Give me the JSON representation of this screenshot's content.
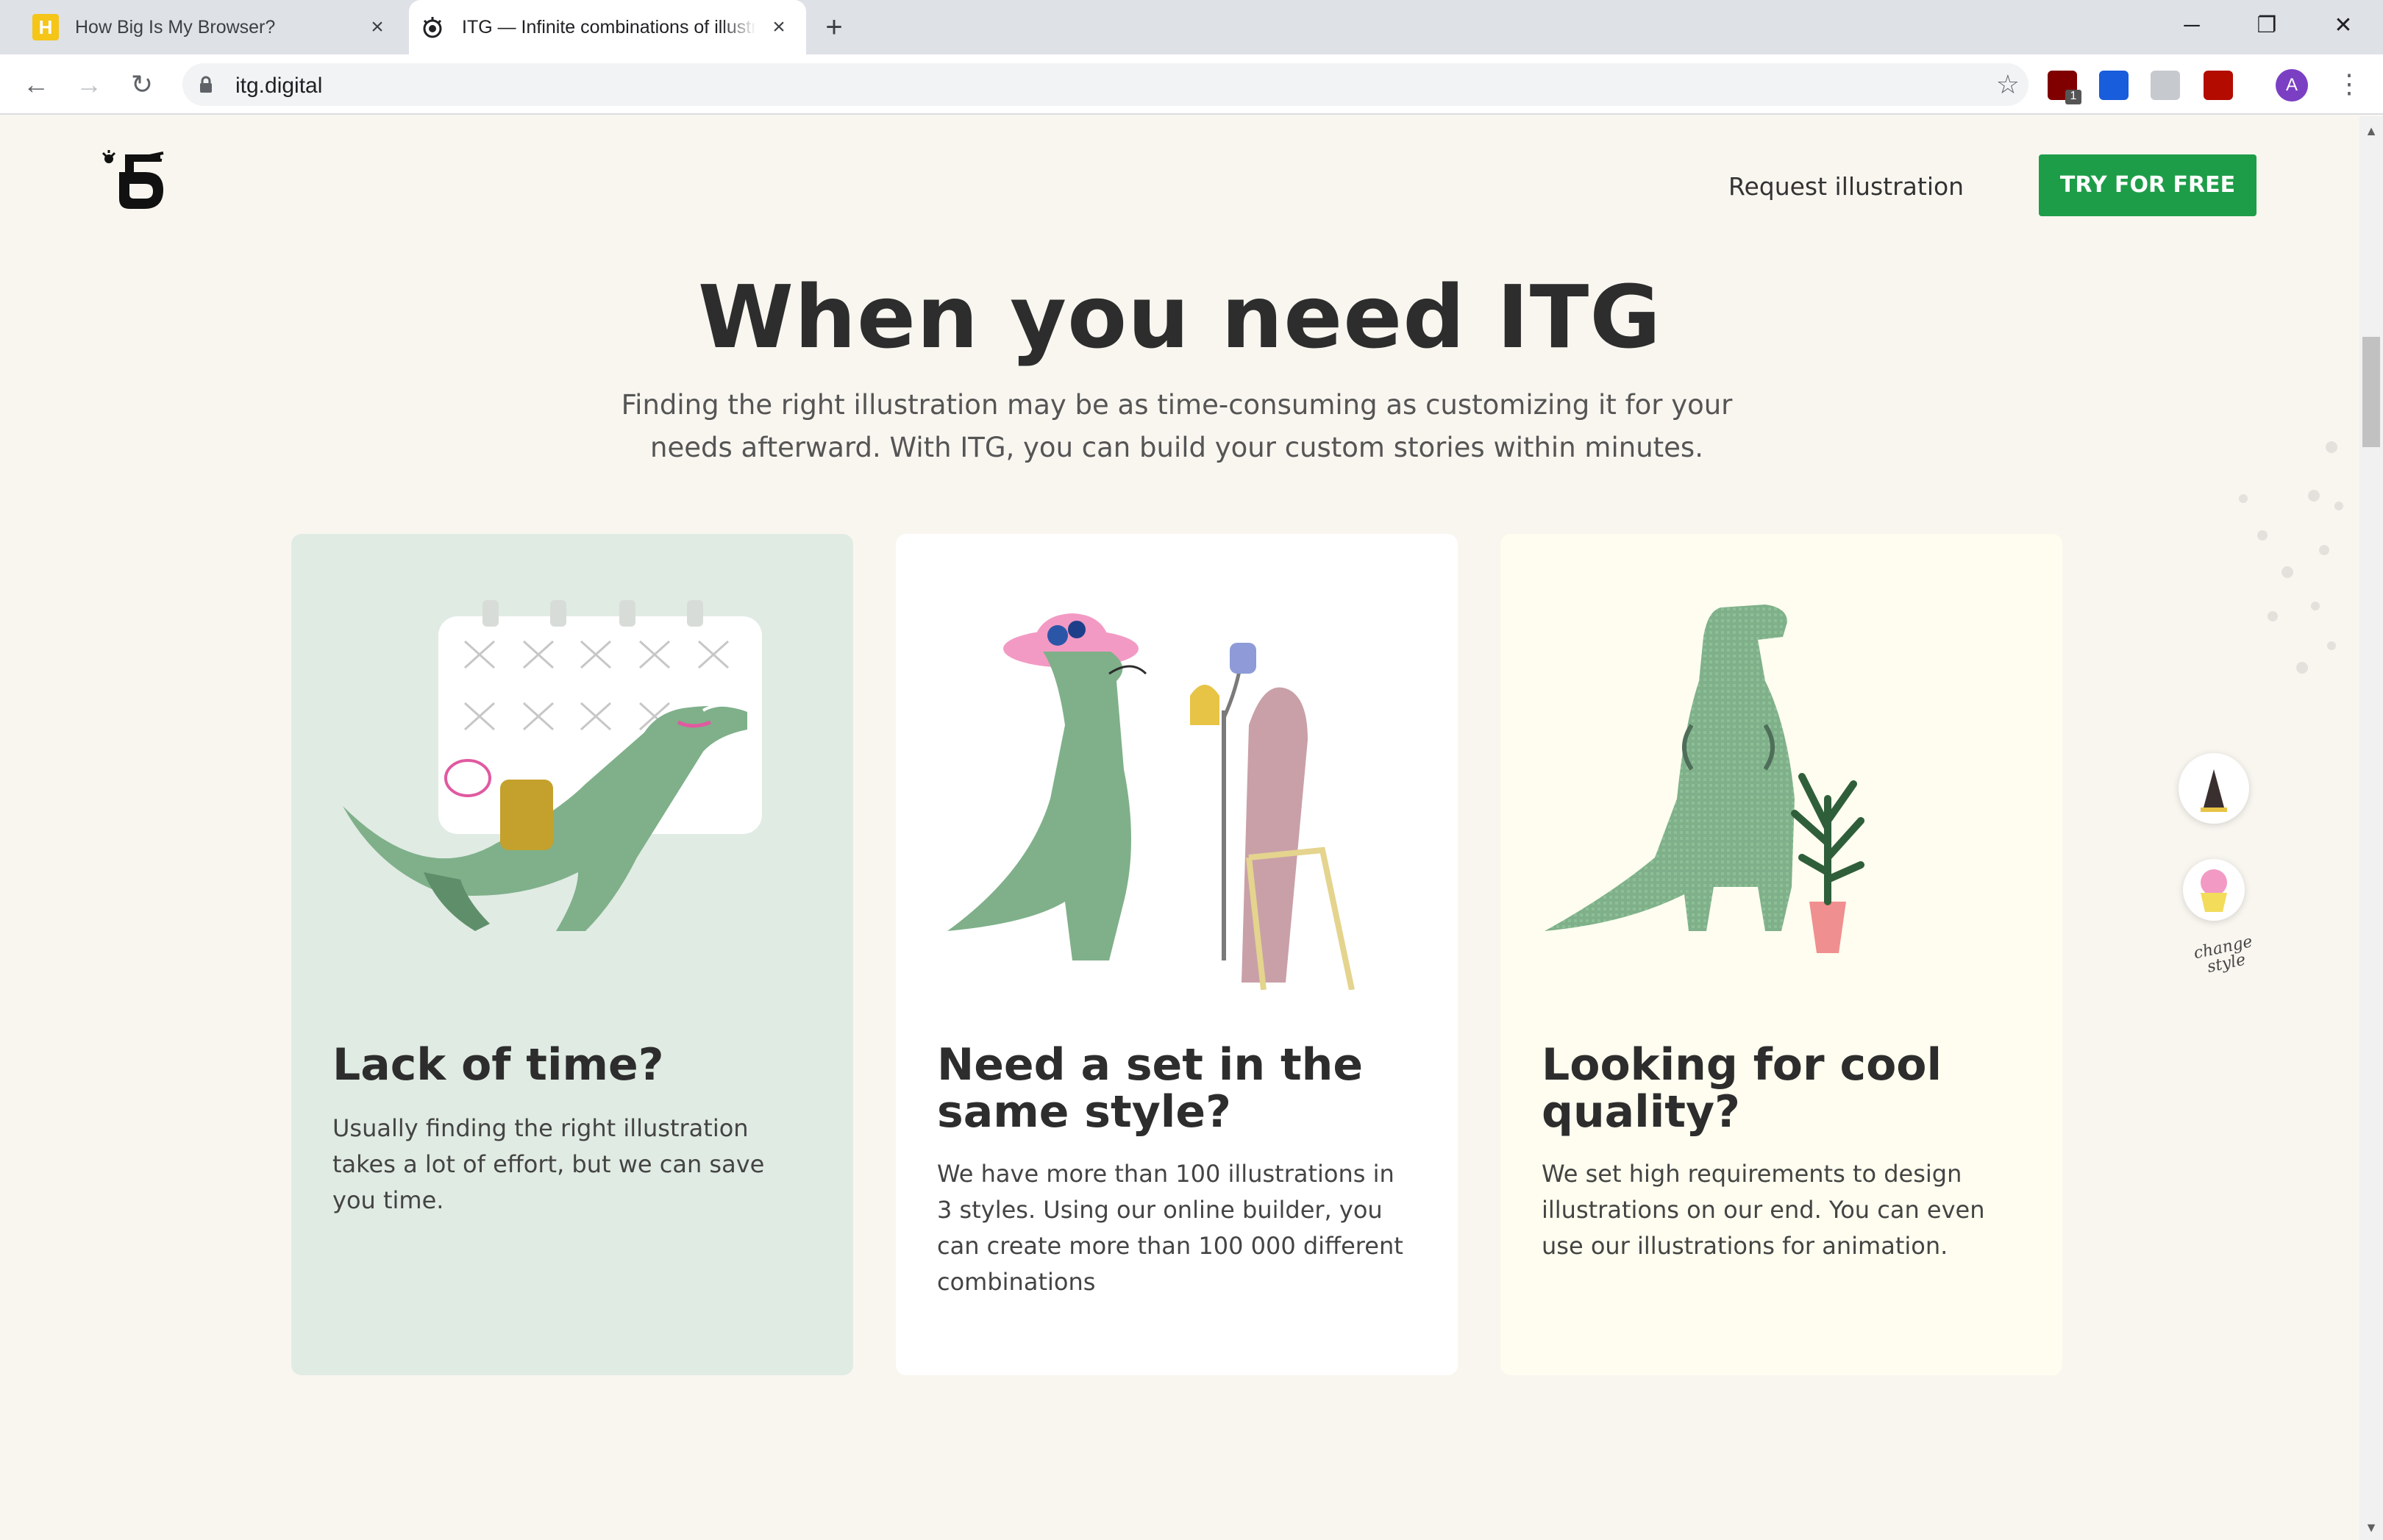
{
  "browser": {
    "tabs": [
      {
        "title": "How Big Is My Browser?",
        "favicon": "H",
        "active": false
      },
      {
        "title": "ITG — Infinite combinations of illustrations",
        "active": true
      }
    ],
    "new_tab_icon": "+",
    "close_icon": "×",
    "url": "itg.digital",
    "profile_initial": "A",
    "extensions": [
      "ublock-icon",
      "bitwarden-icon",
      "css-icon",
      "pdf-icon"
    ],
    "ublock_badge": "1"
  },
  "header": {
    "request_link": "Request illustration",
    "try_button": "TRY FOR FREE"
  },
  "hero": {
    "title": "When you need ITG",
    "subtitle": "Finding the right illustration may be as time-consuming as customizing it for your needs afterward. With ITG, you can build your custom stories within minutes."
  },
  "cards": [
    {
      "title": "Lack of time?",
      "text": "Usually finding the right illustration takes a lot of effort, but we can save you time.",
      "background": "#e0ebe3"
    },
    {
      "title": "Need a set in the same style?",
      "text": "We have more than 100 illustrations in 3 styles. Using our online builder, you can create more than 100 000 different combinations",
      "background": "#ffffff"
    },
    {
      "title": "Looking for cool quality?",
      "text": "We set high requirements to design illustrations on our end. You can even use our illustrations for animation.",
      "background": "#fefdef"
    }
  ],
  "style_switcher": {
    "label": "change style"
  },
  "colors": {
    "accent_green": "#1e9d49",
    "dino_green": "#7fb08a",
    "text_dark": "#2d2d2d"
  }
}
